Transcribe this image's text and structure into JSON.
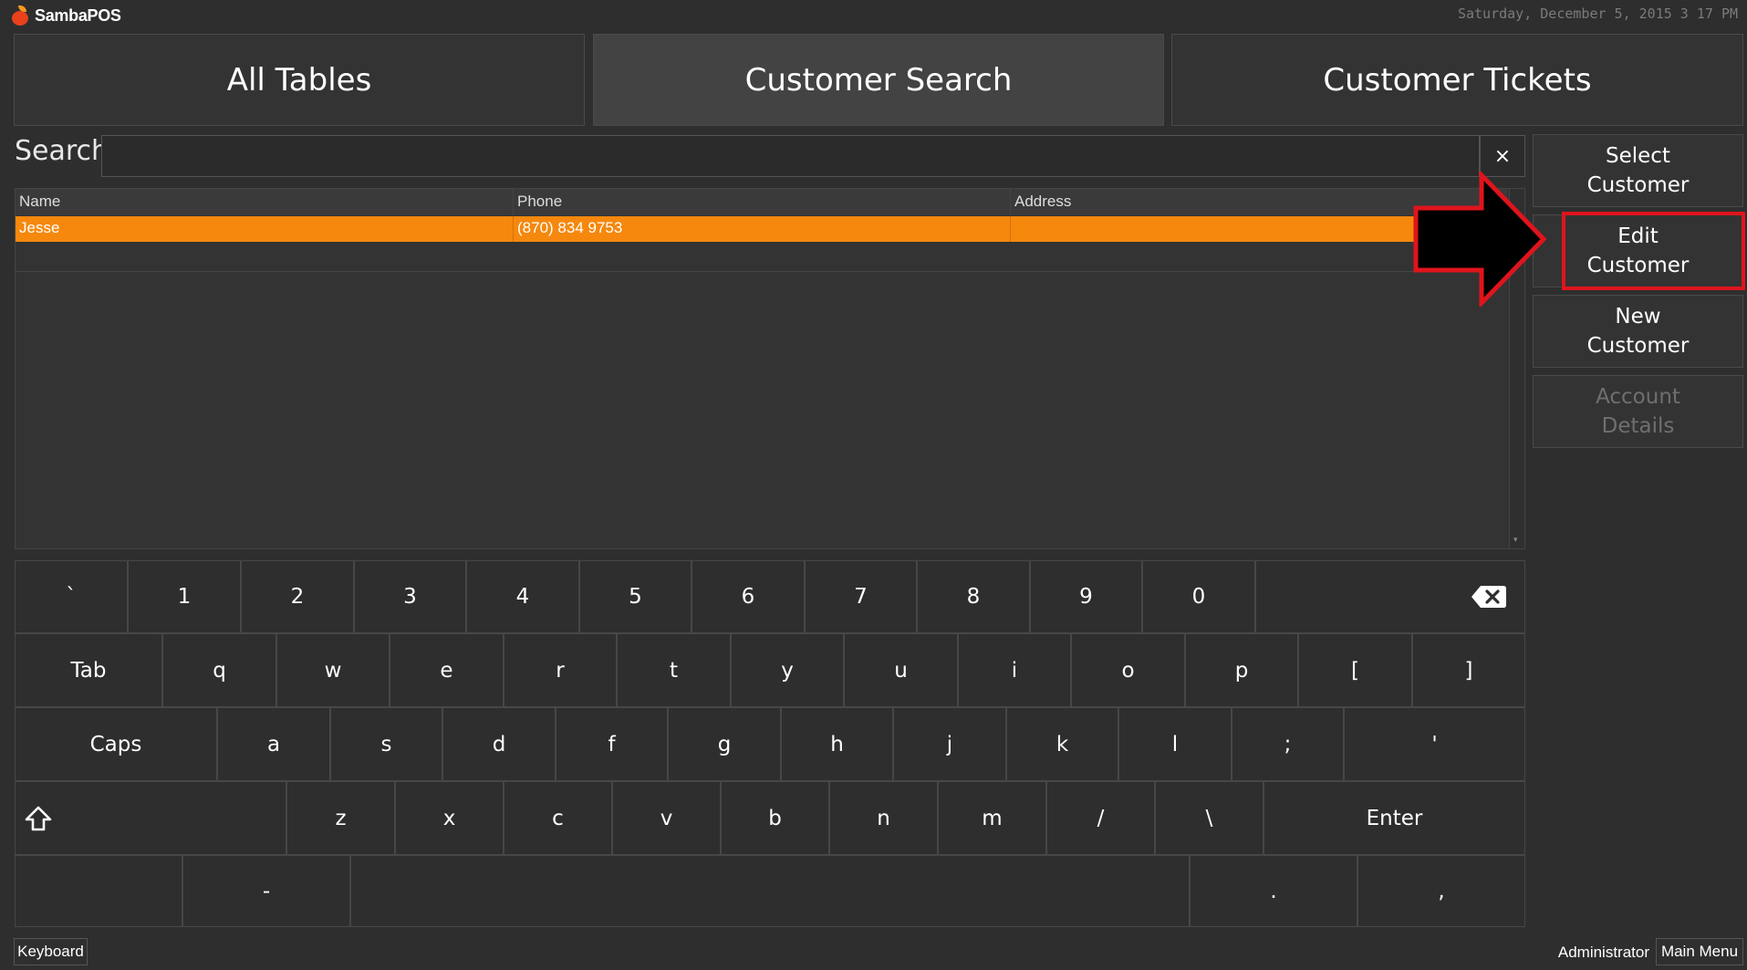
{
  "app": {
    "name": "SambaPOS",
    "datetime": "Saturday, December 5, 2015 3 17 PM"
  },
  "tabs": [
    {
      "label": "All Tables"
    },
    {
      "label": "Customer Search"
    },
    {
      "label": "Customer Tickets"
    }
  ],
  "search": {
    "label": "Search",
    "value": "",
    "clear": "×"
  },
  "grid": {
    "columns": [
      "Name",
      "Phone",
      "Address"
    ],
    "rows": [
      {
        "name": "Jesse",
        "phone": "(870) 834 9753",
        "address": ""
      }
    ],
    "selected_color": "#f5880d"
  },
  "actions": [
    {
      "label": "Select\nCustomer",
      "enabled": true
    },
    {
      "label": "Edit\nCustomer",
      "enabled": true,
      "highlighted": true
    },
    {
      "label": "New\nCustomer",
      "enabled": true
    },
    {
      "label": "Account\nDetails",
      "enabled": false
    }
  ],
  "keyboard": {
    "row1": [
      "`",
      "1",
      "2",
      "3",
      "4",
      "5",
      "6",
      "7",
      "8",
      "9",
      "0"
    ],
    "row2": [
      "Tab",
      "q",
      "w",
      "e",
      "r",
      "t",
      "y",
      "u",
      "i",
      "o",
      "p",
      "[",
      "]"
    ],
    "row3": [
      "Caps",
      "a",
      "s",
      "d",
      "f",
      "g",
      "h",
      "j",
      "k",
      "l",
      ";",
      "'"
    ],
    "row4": [
      "z",
      "x",
      "c",
      "v",
      "b",
      "n",
      "m",
      "/",
      "\\",
      "Enter"
    ],
    "row5": [
      "-",
      ".",
      ","
    ],
    "icons": {
      "backspace": "backspace-icon",
      "shift": "shift-icon"
    }
  },
  "footer": {
    "keyboard": "Keyboard",
    "user": "Administrator",
    "main_menu": "Main Menu"
  },
  "colors": {
    "accent": "#f5880d",
    "highlight": "#e0141c",
    "background": "#2e2e2e"
  }
}
